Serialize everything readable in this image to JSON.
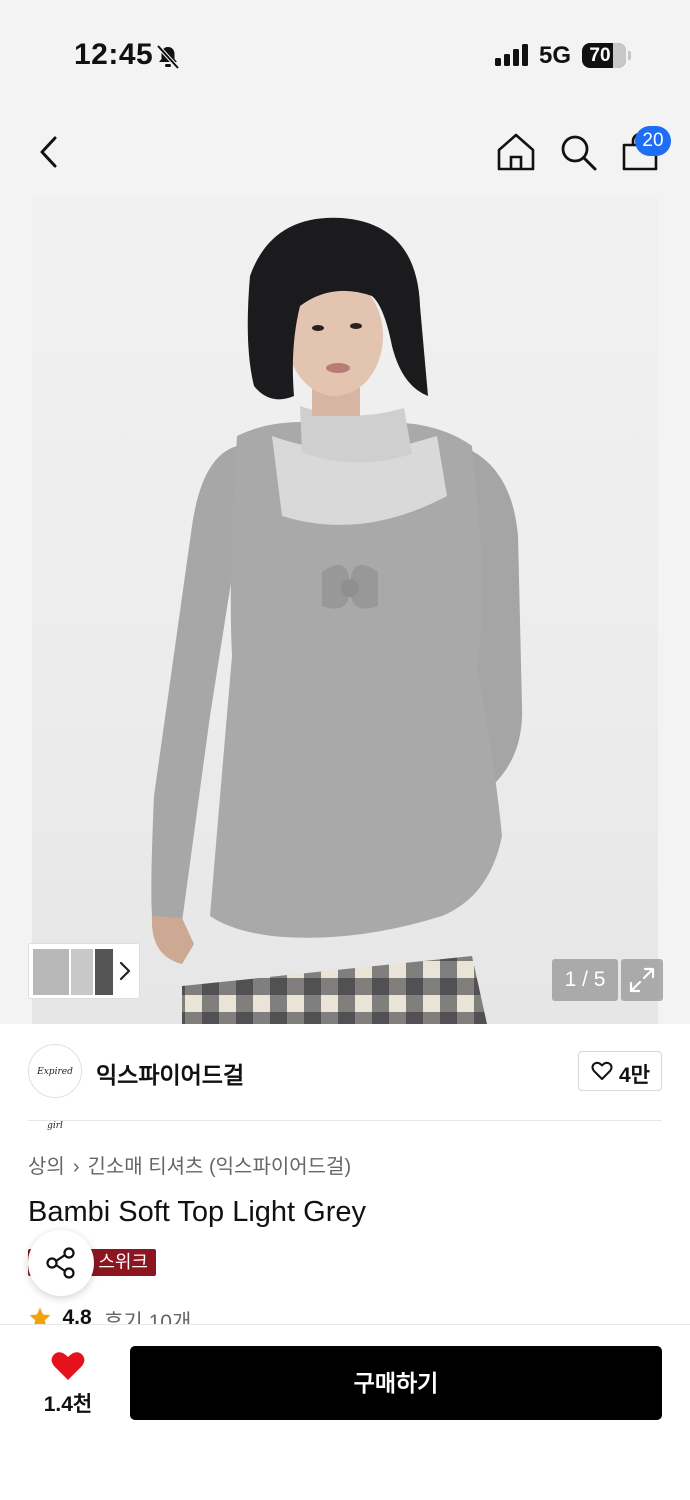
{
  "status_bar": {
    "time": "12:45",
    "network": "5G",
    "battery": "70",
    "battery_level": 0.7
  },
  "header": {
    "icons": [
      "back-icon",
      "home-icon",
      "search-icon",
      "cart-icon"
    ],
    "cart_count": "20"
  },
  "gallery": {
    "counter": "1 / 5",
    "icons": [
      "chevron-right-icon",
      "expand-icon"
    ]
  },
  "brand": {
    "name": "익스파이어드걸",
    "logo_text": "Expired girl",
    "like_count": "4만"
  },
  "product": {
    "breadcrumb": [
      "상의",
      "긴소매 티셔츠 (익스파이어드걸)"
    ],
    "title": "Bambi Soft Top Light Grey",
    "promo_badge": "스위크",
    "rating": "4.8",
    "review_label": "후기 10개"
  },
  "bottom_bar": {
    "like_count": "1.4천",
    "buy_label": "구매하기"
  },
  "colors": {
    "accent_blue": "#1e6df5",
    "like_red": "#e5121c",
    "promo_red": "#8b1620",
    "star_orange": "#f4a20a",
    "button_black": "#000000"
  }
}
